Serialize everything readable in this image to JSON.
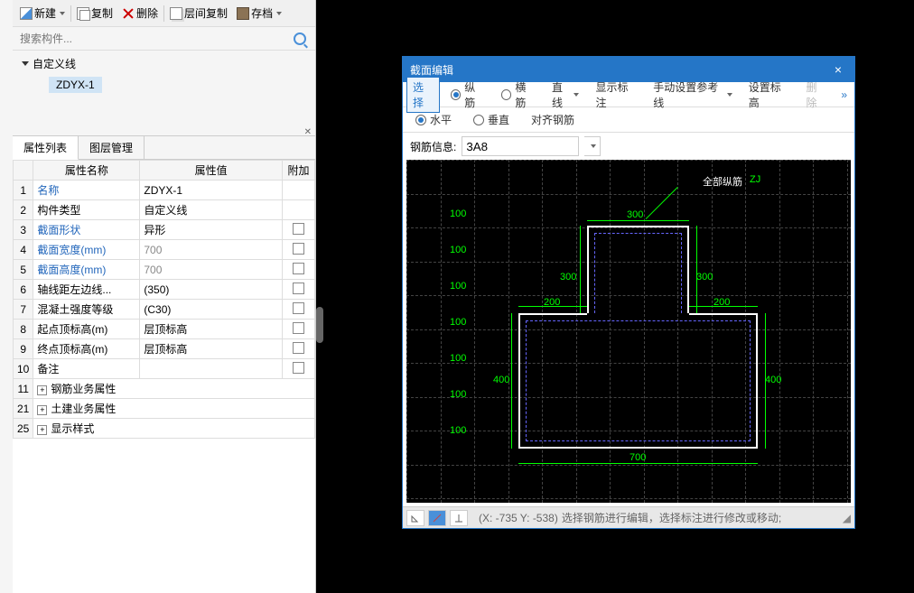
{
  "toolbar": {
    "new": "新建",
    "copy": "复制",
    "delete": "删除",
    "layer_copy": "层间复制",
    "archive": "存档"
  },
  "search": {
    "placeholder": "搜索构件..."
  },
  "tree": {
    "root": "自定义线",
    "child": "ZDYX-1"
  },
  "props": {
    "tab_attr": "属性列表",
    "tab_layer": "图层管理",
    "th_name": "属性名称",
    "th_value": "属性值",
    "th_extra": "附加",
    "rows": [
      {
        "n": "1",
        "name": "名称",
        "val": "ZDYX-1",
        "link": true,
        "chk": null
      },
      {
        "n": "2",
        "name": "构件类型",
        "val": "自定义线",
        "link": false,
        "chk": null
      },
      {
        "n": "3",
        "name": "截面形状",
        "val": "异形",
        "link": true,
        "chk": false
      },
      {
        "n": "4",
        "name": "截面宽度(mm)",
        "val": "700",
        "link": true,
        "gray": true,
        "chk": false
      },
      {
        "n": "5",
        "name": "截面高度(mm)",
        "val": "700",
        "link": true,
        "gray": true,
        "chk": false
      },
      {
        "n": "6",
        "name": "轴线距左边线...",
        "val": "(350)",
        "link": false,
        "chk": false
      },
      {
        "n": "7",
        "name": "混凝土强度等级",
        "val": "(C30)",
        "link": false,
        "chk": false
      },
      {
        "n": "8",
        "name": "起点顶标高(m)",
        "val": "层顶标高",
        "link": false,
        "chk": false
      },
      {
        "n": "9",
        "name": "终点顶标高(m)",
        "val": "层顶标高",
        "link": false,
        "chk": false
      },
      {
        "n": "10",
        "name": "备注",
        "val": "",
        "link": false,
        "chk": false
      },
      {
        "n": "11",
        "name": "钢筋业务属性",
        "val": "",
        "expand": true
      },
      {
        "n": "21",
        "name": "土建业务属性",
        "val": "",
        "expand": true
      },
      {
        "n": "25",
        "name": "显示样式",
        "val": "",
        "expand": true
      }
    ]
  },
  "cad": {
    "title": "截面编辑",
    "close": "×",
    "tools": {
      "select": "选择",
      "vert_rebar": "纵筋",
      "horz_rebar": "横筋",
      "line": "直线",
      "show_label": "显示标注",
      "manual_ref": "手动设置参考线",
      "set_elev": "设置标高",
      "delete": "删除",
      "more": "»"
    },
    "tools2": {
      "horizontal": "水平",
      "vertical": "垂直",
      "align_rebar": "对齐钢筋"
    },
    "info": {
      "label": "钢筋信息:",
      "value": "3A8"
    },
    "canvas": {
      "label_all": "全部纵筋",
      "label_zj": "ZJ",
      "dims": {
        "top": "300",
        "left_up": "300",
        "right_up": "300",
        "left_mid": "200",
        "right_mid": "200",
        "left": "400",
        "right": "400",
        "bottom": "700"
      },
      "ticks": [
        "100",
        "100",
        "100",
        "100",
        "100",
        "100",
        "100"
      ]
    },
    "status": {
      "coords": "(X: -735 Y: -538)",
      "text": "选择钢筋进行编辑，选择标注进行修改或移动;"
    }
  }
}
